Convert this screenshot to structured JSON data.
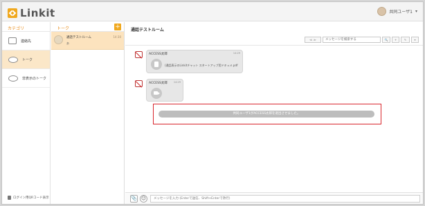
{
  "header": {
    "brand": "Linkit",
    "user_name": "共同ユーザ1",
    "user_menu_caret": "▾"
  },
  "category": {
    "title": "カテゴリ",
    "items": [
      {
        "label": "連絡先",
        "icon": "contacts-icon",
        "active": false
      },
      {
        "label": "トーク",
        "icon": "chat-bubble-icon",
        "active": true
      },
      {
        "label": "非表示のトーク",
        "icon": "hidden-chat-icon",
        "active": false
      }
    ],
    "qr_link": "ログイン用QRコード表示"
  },
  "talks": {
    "title": "トーク",
    "add_label": "+",
    "items": [
      {
        "name": "通話テストルーム",
        "subtitle": "あ",
        "time": "14:30"
      }
    ]
  },
  "room": {
    "title": "通話テストルーム",
    "toolbar": {
      "prev_label": "≪ ≫",
      "search_placeholder": "メッセージを検索する",
      "search_icon": "🔍",
      "add_label": "+",
      "edit_label": "✎",
      "menu_label": "▾"
    },
    "messages": [
      {
        "sender": "ACCESS太郎",
        "time": "14:29",
        "kind": "file",
        "text": "(通話表示のLinkitチャット スタートアップ用ドキュメ.pdf"
      },
      {
        "sender": "ACCESS太郎",
        "time": "14:29",
        "kind": "video",
        "text": ""
      }
    ],
    "system_message": "共同ユーザ1がACCESS太郎を退出させました。",
    "compose": {
      "attach_icon": "📎",
      "emoji_icon": "☺",
      "placeholder": "メッセージを入力 (Enterで送信、Shift+Enterで改行)"
    }
  },
  "colors": {
    "accent": "#f0a81e",
    "active_row": "#fbe7c8",
    "highlight_border": "#d8232a"
  }
}
